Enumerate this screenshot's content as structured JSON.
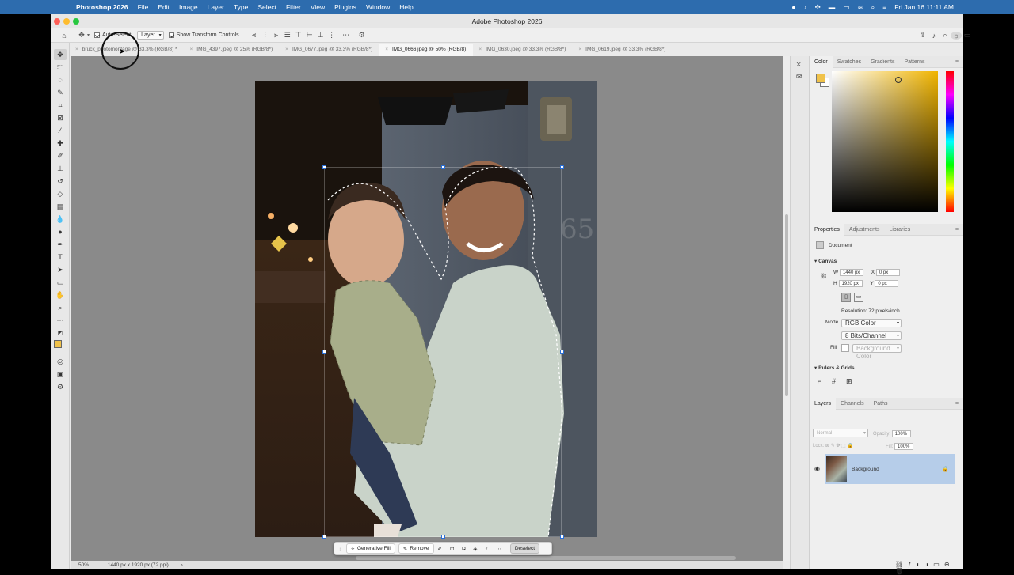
{
  "menubar": {
    "app": "Photoshop 2026",
    "items": [
      "File",
      "Edit",
      "Image",
      "Layer",
      "Type",
      "Select",
      "Filter",
      "View",
      "Plugins",
      "Window",
      "Help"
    ],
    "datetime": "Fri Jan 16  11:11 AM"
  },
  "window": {
    "title": "Adobe Photoshop 2026"
  },
  "options": {
    "auto_select_label": "Auto-Select:",
    "auto_select_target": "Layer",
    "show_transform_label": "Show Transform Controls"
  },
  "tabs": [
    {
      "label": "bruck_photomontage @ 33.3% (RGB/8) *"
    },
    {
      "label": "IMG_4397.jpeg @ 25% (RGB/8*)"
    },
    {
      "label": "IMG_0677.jpeg @ 33.3% (RGB/8*)"
    },
    {
      "label": "IMG_0666.jpeg @ 50% (RGB/8)"
    },
    {
      "label": "IMG_0630.jpeg @ 33.3% (RGB/8*)"
    },
    {
      "label": "IMG_0619.jpeg @ 33.3% (RGB/8*)"
    }
  ],
  "active_tab_index": 3,
  "photo_text": {
    "address": "65"
  },
  "status": {
    "zoom": "50%",
    "doc_info": "1440 px x 1920 px (72 ppi)"
  },
  "context_bar": {
    "generative_fill": "Generative Fill",
    "remove": "Remove",
    "deselect": "Deselect"
  },
  "color_panel": {
    "tabs": [
      "Color",
      "Swatches",
      "Gradients",
      "Patterns"
    ],
    "foreground": "#f0c24a",
    "background": "#ffffff"
  },
  "properties": {
    "tabs": [
      "Properties",
      "Adjustments",
      "Libraries"
    ],
    "doc_label": "Document",
    "canvas_title": "Canvas",
    "w_label": "W",
    "w_value": "1440 px",
    "h_label": "H",
    "h_value": "1920 px",
    "x_label": "X",
    "x_value": "0 px",
    "y_label": "Y",
    "y_value": "0 px",
    "resolution": "Resolution: 72 pixels/inch",
    "mode_label": "Mode",
    "mode_value": "RGB Color",
    "bits_value": "8 Bits/Channel",
    "fill_label": "Fill",
    "fill_value": "Background Color",
    "rulers_title": "Rulers & Grids"
  },
  "layers": {
    "tabs": [
      "Layers",
      "Channels",
      "Paths"
    ],
    "blend_mode": "Normal",
    "opacity_label": "Opacity:",
    "opacity_value": "100%",
    "lock_label": "Lock:",
    "fill_label": "Fill:",
    "fill_value": "100%",
    "items": [
      {
        "name": "Background"
      }
    ]
  }
}
